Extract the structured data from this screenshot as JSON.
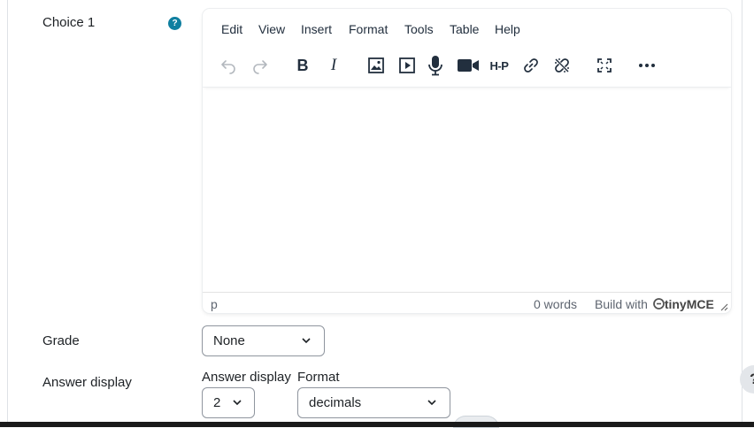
{
  "choice": {
    "label": "Choice 1",
    "help_icon": "?"
  },
  "editor": {
    "menu": [
      "Edit",
      "View",
      "Insert",
      "Format",
      "Tools",
      "Table",
      "Help"
    ],
    "toolbar_icons": [
      "undo-icon",
      "redo-icon",
      "bold-icon",
      "italic-icon",
      "image-icon",
      "media-icon",
      "microphone-icon",
      "video-camera-icon",
      "h5p-icon",
      "link-icon",
      "unlink-icon",
      "fullscreen-icon",
      "more-icon"
    ],
    "toolbar_text": {
      "bold": "B",
      "italic": "I",
      "h5p": "H-P"
    },
    "status_path": "p",
    "word_count": "0 words",
    "brand_prefix": "Build with",
    "brand_name": "tinyMCE"
  },
  "grade": {
    "label": "Grade",
    "value": "None"
  },
  "answer_display": {
    "label": "Answer display",
    "sub_label": "Answer display",
    "value": "2",
    "format_label": "Format",
    "format_value": "decimals"
  },
  "floating_help": "?"
}
